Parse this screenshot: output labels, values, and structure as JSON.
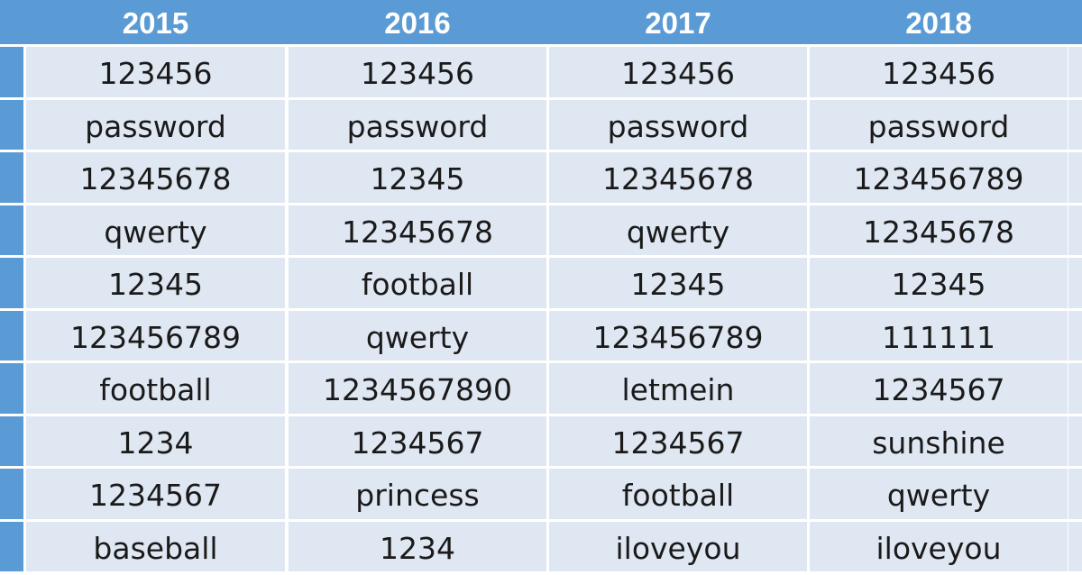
{
  "colors": {
    "header": "#5b9bd5",
    "cell": "#dfe7f2",
    "header_text": "#ffffff"
  },
  "table": {
    "columns": [
      "2015",
      "2016",
      "2017",
      "2018"
    ],
    "rows": [
      [
        "123456",
        "123456",
        "123456",
        "123456"
      ],
      [
        "password",
        "password",
        "password",
        "password"
      ],
      [
        "12345678",
        "12345",
        "12345678",
        "123456789"
      ],
      [
        "qwerty",
        "12345678",
        "qwerty",
        "12345678"
      ],
      [
        "12345",
        "football",
        "12345",
        "12345"
      ],
      [
        "123456789",
        "qwerty",
        "123456789",
        "111111"
      ],
      [
        "football",
        "1234567890",
        "letmein",
        "1234567"
      ],
      [
        "1234",
        "1234567",
        "1234567",
        "sunshine"
      ],
      [
        "1234567",
        "princess",
        "football",
        "qwerty"
      ],
      [
        "baseball",
        "1234",
        "iloveyou",
        "iloveyou"
      ]
    ]
  }
}
